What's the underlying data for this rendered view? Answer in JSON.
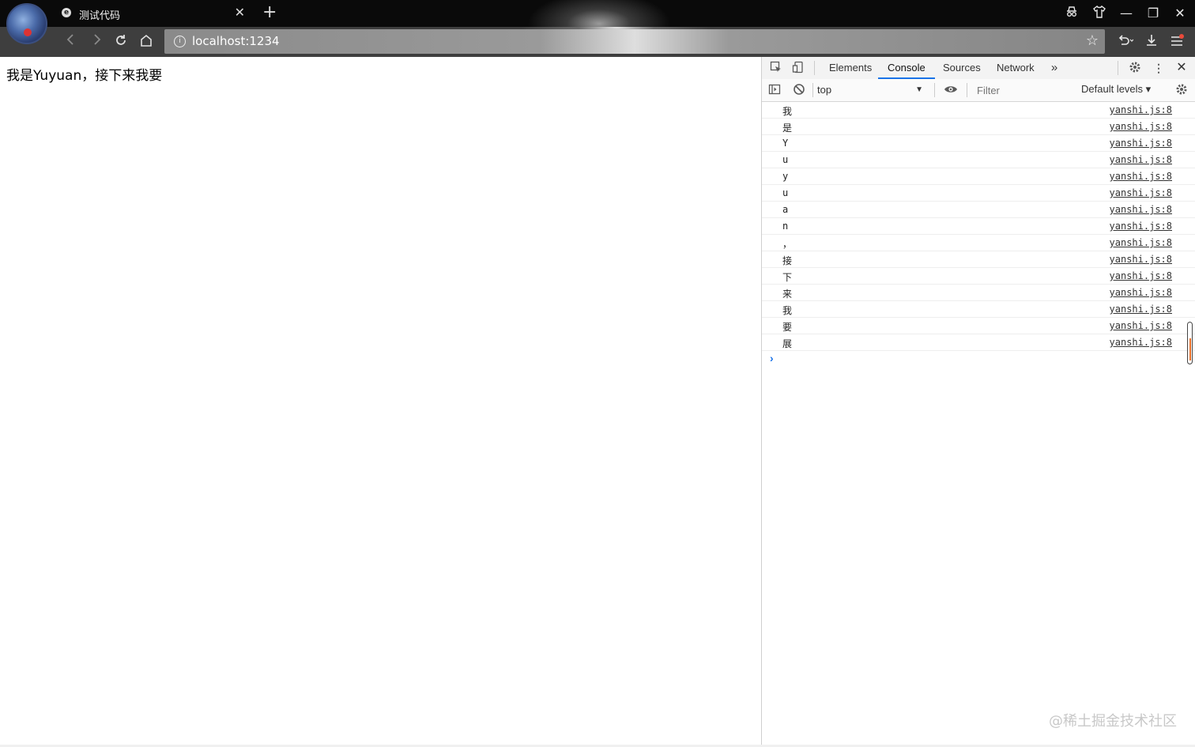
{
  "browser": {
    "tab_title": "测试代码",
    "tab_favicon": "e",
    "tab_close": "✕",
    "new_tab": "+",
    "url": "localhost:1234",
    "window": {
      "minimize": "—",
      "restore": "❐",
      "close": "✕"
    }
  },
  "page": {
    "text": "我是Yuyuan，接下来我要"
  },
  "devtools": {
    "tabs": [
      "Elements",
      "Console",
      "Sources",
      "Network"
    ],
    "active_tab": "Console",
    "more_tabs": "»",
    "context": "top",
    "filter_placeholder": "Filter",
    "levels": "Default levels ▾",
    "prompt": "›",
    "logs": [
      {
        "msg": "我",
        "src": "yanshi.js:8"
      },
      {
        "msg": "是",
        "src": "yanshi.js:8"
      },
      {
        "msg": "Y",
        "src": "yanshi.js:8"
      },
      {
        "msg": "u",
        "src": "yanshi.js:8"
      },
      {
        "msg": "y",
        "src": "yanshi.js:8"
      },
      {
        "msg": "u",
        "src": "yanshi.js:8"
      },
      {
        "msg": "a",
        "src": "yanshi.js:8"
      },
      {
        "msg": "n",
        "src": "yanshi.js:8"
      },
      {
        "msg": "，",
        "src": "yanshi.js:8"
      },
      {
        "msg": "接",
        "src": "yanshi.js:8"
      },
      {
        "msg": "下",
        "src": "yanshi.js:8"
      },
      {
        "msg": "来",
        "src": "yanshi.js:8"
      },
      {
        "msg": "我",
        "src": "yanshi.js:8"
      },
      {
        "msg": "要",
        "src": "yanshi.js:8"
      },
      {
        "msg": "展",
        "src": "yanshi.js:8"
      }
    ]
  },
  "watermark": "@稀土掘金技术社区"
}
